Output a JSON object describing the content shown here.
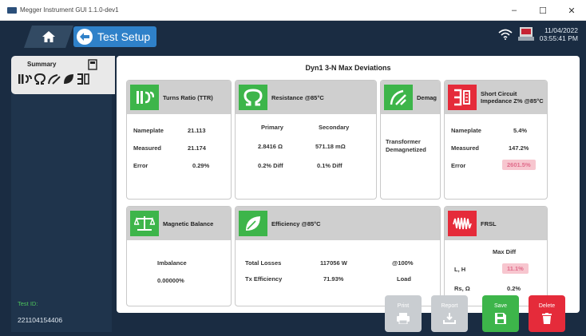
{
  "window": {
    "title": "Megger Instrument GUI 1.1.0-dev1",
    "min": "–",
    "max": "☐",
    "close": "✕"
  },
  "topbar": {
    "back_label": "Test Setup",
    "date": "11/04/2022",
    "time": "03:55:41 PM"
  },
  "nav": {
    "summary_label": "Summary"
  },
  "content": {
    "title": "Dyn1 3-N Max Deviations"
  },
  "cards": {
    "ttr": {
      "title": "Turns Ratio (TTR)",
      "nameplate_label": "Nameplate",
      "nameplate": "21.113",
      "measured_label": "Measured",
      "measured": "21.174",
      "error_label": "Error",
      "error": "0.29%"
    },
    "resistance": {
      "title": "Resistance @85°C",
      "primary_label": "Primary",
      "secondary_label": "Secondary",
      "primary_value": "2.8416 Ω",
      "secondary_value": "571.18 mΩ",
      "primary_diff": "0.2% Diff",
      "secondary_diff": "0.1% Diff"
    },
    "demag": {
      "title": "Demag",
      "status": "Transformer Demagnetized"
    },
    "sc": {
      "title": "Short Circuit Impedance Z% @85°C",
      "nameplate_label": "Nameplate",
      "nameplate": "5.4%",
      "measured_label": "Measured",
      "measured": "147.2%",
      "error_label": "Error",
      "error": "2601.5%"
    },
    "magnetic": {
      "title": "Magnetic Balance",
      "imbalance_label": "Imbalance",
      "imbalance": "0.00000%"
    },
    "efficiency": {
      "title": "Efficiency @85°C",
      "losses_label": "Total Losses",
      "losses": "117056 W",
      "load1": "@100%",
      "eff_label": "Tx Efficiency",
      "eff": "71.93%",
      "load2": "Load"
    },
    "frsl": {
      "title": "FRSL",
      "maxdiff_label": "Max Diff",
      "lh_label": "L, H",
      "lh": "11.1%",
      "rs_label": "Rs, Ω",
      "rs": "0.2%"
    }
  },
  "testid": {
    "label": "Test ID:",
    "value": "221104154406"
  },
  "actions": {
    "print": "Print",
    "report": "Report",
    "save": "Save",
    "delete": "Delete"
  },
  "colors": {
    "app_bg": "#1a2c42",
    "accent_blue": "#2f81c9",
    "green": "#3db54a",
    "red": "#e52b3a"
  }
}
